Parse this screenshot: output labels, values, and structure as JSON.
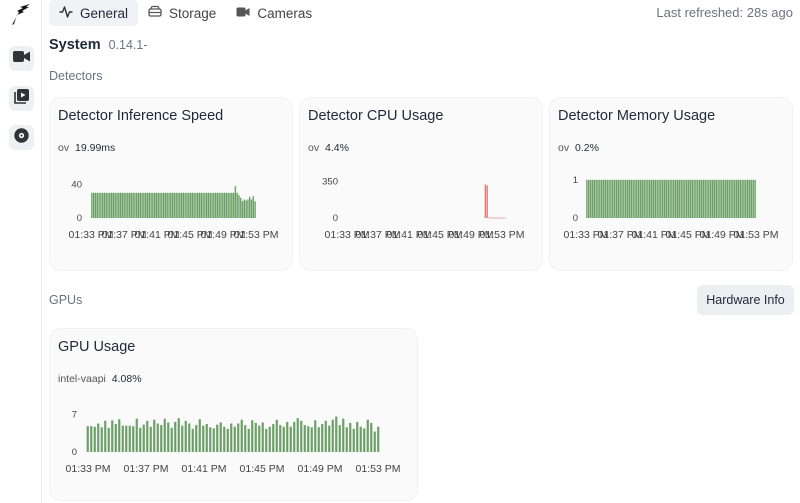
{
  "tabs": [
    {
      "label": "General",
      "icon": "activity-icon",
      "active": true
    },
    {
      "label": "Storage",
      "icon": "hard-drive-icon",
      "active": false
    },
    {
      "label": "Cameras",
      "icon": "video-icon",
      "active": false
    }
  ],
  "last_refreshed": "Last refreshed: 28s ago",
  "system": {
    "title": "System",
    "version": "0.14.1-"
  },
  "detectors_label": "Detectors",
  "gpus_label": "GPUs",
  "hardware_info_label": "Hardware Info",
  "accent_color": "#6a9f65",
  "alert_color": "#e07a7a",
  "cards": {
    "inference": {
      "title": "Detector Inference Speed",
      "name": "ov",
      "value": "19.99ms"
    },
    "cpu": {
      "title": "Detector CPU Usage",
      "name": "ov",
      "value": "4.4%"
    },
    "memory": {
      "title": "Detector Memory Usage",
      "name": "ov",
      "value": "0.2%"
    },
    "gpu": {
      "title": "GPU Usage",
      "name": "intel-vaapi",
      "value": "4.08%"
    }
  },
  "chart_data": [
    {
      "type": "bar",
      "name": "inference",
      "x_ticks": [
        "01:33 PM",
        "01:37 PM",
        "01:41 PM",
        "01:45 PM",
        "01:49 PM",
        "01:53 PM"
      ],
      "y_ticks": [
        "0",
        "40"
      ],
      "ylim": [
        0,
        50
      ],
      "color": "#6a9f65",
      "values": [
        30,
        30,
        30,
        30,
        30,
        30,
        30,
        30,
        30,
        30,
        30,
        30,
        30,
        30,
        30,
        30,
        30,
        30,
        30,
        30,
        30,
        30,
        30,
        30,
        30,
        30,
        30,
        30,
        30,
        30,
        30,
        30,
        30,
        30,
        30,
        30,
        30,
        30,
        30,
        30,
        30,
        30,
        30,
        30,
        30,
        30,
        30,
        30,
        30,
        30,
        30,
        30,
        30,
        30,
        30,
        30,
        30,
        30,
        30,
        30,
        30,
        30,
        30,
        30,
        30,
        30,
        30,
        30,
        30,
        30,
        30,
        30,
        30,
        30,
        30,
        30,
        30,
        30,
        30,
        30,
        38,
        30,
        27,
        24,
        20,
        22,
        21,
        22,
        25,
        22,
        26,
        20
      ]
    },
    {
      "type": "bar",
      "name": "cpu",
      "x_ticks": [
        "01:33 PM",
        "01:37 PM",
        "01:41 PM",
        "01:45 PM",
        "01:49 PM",
        "01:53 PM"
      ],
      "y_ticks": [
        "0",
        "350"
      ],
      "ylim": [
        0,
        400
      ],
      "color": "#e07a7a",
      "values": [
        0,
        0,
        0,
        0,
        0,
        0,
        0,
        0,
        0,
        0,
        0,
        0,
        0,
        0,
        0,
        0,
        0,
        0,
        0,
        0,
        0,
        0,
        0,
        0,
        0,
        0,
        0,
        0,
        0,
        0,
        0,
        0,
        0,
        0,
        0,
        0,
        0,
        0,
        0,
        0,
        0,
        0,
        0,
        0,
        0,
        0,
        0,
        0,
        0,
        0,
        0,
        0,
        0,
        0,
        0,
        0,
        0,
        0,
        0,
        0,
        0,
        0,
        0,
        0,
        0,
        0,
        0,
        0,
        0,
        0,
        0,
        0,
        0,
        0,
        0,
        0,
        0,
        0,
        0,
        0,
        320,
        310,
        4,
        4,
        4,
        3,
        4,
        3,
        4,
        3,
        4,
        3
      ]
    },
    {
      "type": "bar",
      "name": "memory",
      "x_ticks": [
        "01:33 PM",
        "01:37 PM",
        "01:41 PM",
        "01:45 PM",
        "01:49 PM",
        "01:53 PM"
      ],
      "y_ticks": [
        "0",
        "1"
      ],
      "ylim": [
        0,
        1.1
      ],
      "color": "#6a9f65",
      "values": [
        1,
        1,
        1,
        1,
        1,
        1,
        1,
        1,
        1,
        1,
        1,
        1,
        1,
        1,
        1,
        1,
        1,
        1,
        1,
        1,
        1,
        1,
        1,
        1,
        1,
        1,
        1,
        1,
        1,
        1,
        1,
        1,
        1,
        1,
        1,
        1,
        1,
        1,
        1,
        1,
        1,
        1,
        1,
        1,
        1,
        1,
        1,
        1,
        1,
        1,
        1,
        1,
        1,
        1,
        1,
        1,
        1,
        1,
        1,
        1,
        1,
        1,
        1,
        1,
        1,
        1,
        1,
        1,
        1,
        1,
        1,
        1,
        1,
        1,
        1,
        1,
        1,
        1,
        1,
        1,
        1,
        1,
        1,
        1,
        1,
        1,
        1,
        1,
        1,
        1,
        1,
        1
      ]
    },
    {
      "type": "bar",
      "name": "gpu",
      "x_ticks": [
        "01:33 PM",
        "01:37 PM",
        "01:41 PM",
        "01:45 PM",
        "01:49 PM",
        "01:53 PM"
      ],
      "y_ticks": [
        "0",
        "7"
      ],
      "ylim": [
        0,
        8
      ],
      "color": "#6a9f65",
      "values": [
        4.8,
        4.8,
        4.7,
        5.3,
        4.6,
        5.8,
        4.5,
        5.9,
        5.2,
        6.1,
        4.9,
        4.9,
        4.9,
        4.8,
        6.2,
        4.5,
        5.1,
        5.8,
        4.7,
        6.0,
        5.3,
        5.0,
        6.2,
        5.5,
        4.5,
        5.6,
        6.3,
        4.9,
        5.8,
        5.3,
        4.3,
        5.0,
        6.1,
        4.9,
        5.2,
        4.6,
        4.4,
        5.1,
        5.5,
        4.7,
        4.3,
        5.3,
        4.7,
        5.3,
        6.0,
        5.0,
        4.3,
        5.9,
        5.4,
        4.9,
        5.5,
        4.3,
        4.7,
        5.2,
        6.0,
        5.0,
        4.7,
        5.6,
        4.7,
        5.6,
        6.3,
        5.8,
        5.0,
        4.8,
        4.6,
        5.9,
        4.6,
        5.2,
        5.8,
        4.9,
        6.0,
        6.6,
        5.0,
        6.2,
        4.6,
        5.4,
        4.3,
        5.6,
        4.7,
        4.4,
        6.0,
        5.4,
        3.8,
        4.7
      ]
    }
  ]
}
